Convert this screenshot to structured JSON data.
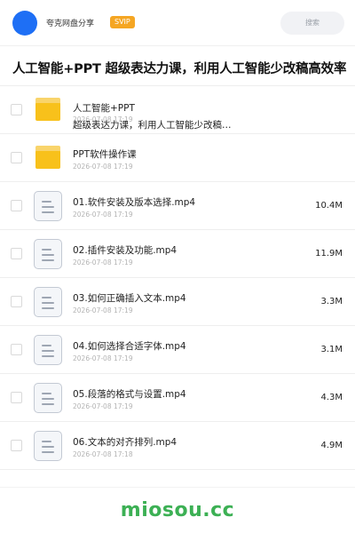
{
  "header": {
    "share_name": "夸克网盘分享",
    "badge": "SVIP",
    "search_placeholder": "搜索"
  },
  "share_title": "人工智能+PPT 超级表达力课，利用人工智能少改稿高效率",
  "files": [
    {
      "type": "folder",
      "name": "人工智能+PPT",
      "name_line2": "超级表达力课，利用人工智能少改稿…",
      "meta": "2026-07-08 17:19",
      "size": ""
    },
    {
      "type": "folder",
      "name": "PPT软件操作课",
      "meta": "2026-07-08 17:19",
      "size": ""
    },
    {
      "type": "file",
      "name": "01.软件安装及版本选择.mp4",
      "meta": "2026-07-08 17:19",
      "size": "10.4M"
    },
    {
      "type": "file",
      "name": "02.插件安装及功能.mp4",
      "meta": "2026-07-08 17:19",
      "size": "11.9M"
    },
    {
      "type": "file",
      "name": "03.如何正确插入文本.mp4",
      "meta": "2026-07-08 17:19",
      "size": "3.3M"
    },
    {
      "type": "file",
      "name": "04.如何选择合适字体.mp4",
      "meta": "2026-07-08 17:19",
      "size": "3.1M"
    },
    {
      "type": "file",
      "name": "05.段落的格式与设置.mp4",
      "meta": "2026-07-08 17:19",
      "size": "4.3M"
    },
    {
      "type": "file",
      "name": "06.文本的对齐排列.mp4",
      "meta": "2026-07-08 17:18",
      "size": "4.9M"
    }
  ],
  "watermark": "miosou.cc",
  "colors": {
    "accent": "#1e6ff5",
    "badge": "#f5a623",
    "folder": "#f8c11b",
    "watermark": "#3cb054"
  }
}
